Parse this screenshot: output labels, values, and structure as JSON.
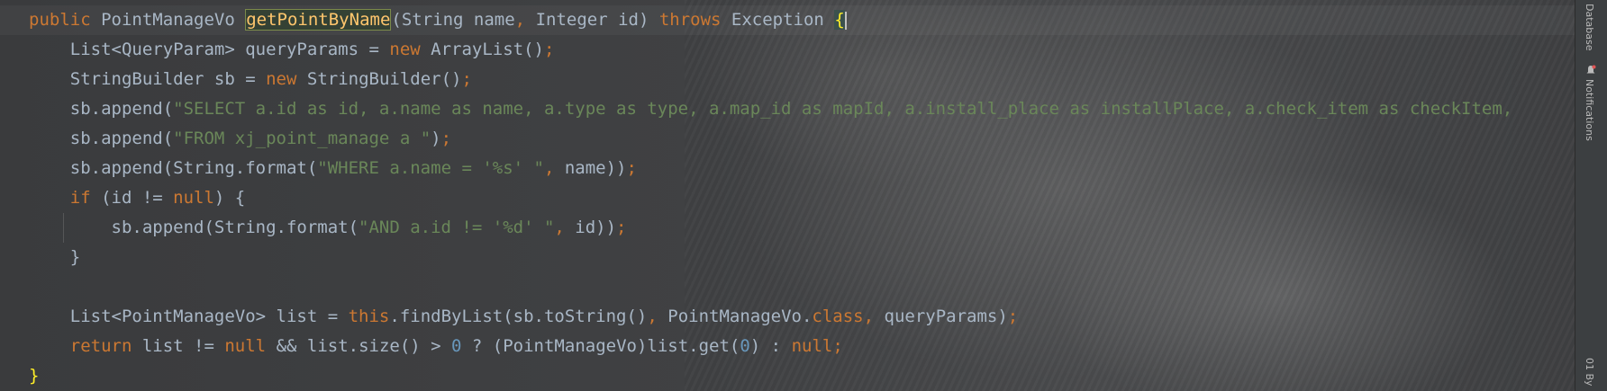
{
  "editor": {
    "lines": [
      [
        [
          "kw",
          "public "
        ],
        [
          "p",
          "PointManageVo "
        ],
        [
          "fnhl",
          "getPointByName"
        ],
        [
          "p",
          "(String name"
        ],
        [
          "kw",
          ", "
        ],
        [
          "p",
          "Integer id) "
        ],
        [
          "kw",
          "throws "
        ],
        [
          "p",
          "Exception "
        ],
        [
          "bracehl",
          "{"
        ]
      ],
      [
        [
          "p",
          "    List<QueryParam> queryParams = "
        ],
        [
          "kw",
          "new "
        ],
        [
          "p",
          "ArrayList()"
        ],
        [
          "kw",
          ";"
        ]
      ],
      [
        [
          "p",
          "    StringBuilder sb = "
        ],
        [
          "kw",
          "new "
        ],
        [
          "p",
          "StringBuilder()"
        ],
        [
          "kw",
          ";"
        ]
      ],
      [
        [
          "p",
          "    sb.append("
        ],
        [
          "str",
          "\"SELECT a.id as id, a.name as name, a.type as type, a.map_id as mapId, a.install_place as installPlace, a.check_item as checkItem, "
        ]
      ],
      [
        [
          "p",
          "    sb.append("
        ],
        [
          "str",
          "\"FROM xj_point_manage a \""
        ],
        [
          "p",
          ")"
        ],
        [
          "kw",
          ";"
        ]
      ],
      [
        [
          "p",
          "    sb.append(String.format("
        ],
        [
          "str",
          "\"WHERE a.name = '%s' \""
        ],
        [
          "kw",
          ", "
        ],
        [
          "p",
          "name))"
        ],
        [
          "kw",
          ";"
        ]
      ],
      [
        [
          "kw",
          "    if "
        ],
        [
          "p",
          "(id != "
        ],
        [
          "kw",
          "null"
        ],
        [
          "p",
          ") {"
        ]
      ],
      [
        [
          "p",
          "        sb.append(String.format("
        ],
        [
          "str",
          "\"AND a.id != '%d' \""
        ],
        [
          "kw",
          ", "
        ],
        [
          "p",
          "id))"
        ],
        [
          "kw",
          ";"
        ]
      ],
      [
        [
          "p",
          "    }"
        ]
      ],
      [
        [
          "p",
          ""
        ]
      ],
      [
        [
          "p",
          "    List<PointManageVo> list = "
        ],
        [
          "kw",
          "this"
        ],
        [
          "p",
          ".findByList(sb.toString()"
        ],
        [
          "kw",
          ", "
        ],
        [
          "p",
          "PointManageVo."
        ],
        [
          "kw",
          "class"
        ],
        [
          "kw",
          ", "
        ],
        [
          "p",
          "queryParams)"
        ],
        [
          "kw",
          ";"
        ]
      ],
      [
        [
          "kw",
          "    return "
        ],
        [
          "p",
          "list != "
        ],
        [
          "kw",
          "null "
        ],
        [
          "p",
          "&& list.size() > "
        ],
        [
          "num",
          "0"
        ],
        [
          "p",
          " ? (PointManageVo)list.get("
        ],
        [
          "num",
          "0"
        ],
        [
          "p",
          ") : "
        ],
        [
          "kw",
          "null"
        ],
        [
          "kw",
          ";"
        ]
      ],
      [
        [
          "braceyellow",
          "}"
        ]
      ]
    ]
  },
  "right_panel": {
    "database_label": "Database",
    "notifications_label": "Notifications",
    "bottom_label": "01 By"
  },
  "colors": {
    "keyword": "#cc7832",
    "string": "#6a8759",
    "number": "#6897bb",
    "plain": "#a9b7c6",
    "method_highlight": "#ffc66d",
    "brace_match": "#ffef28"
  }
}
